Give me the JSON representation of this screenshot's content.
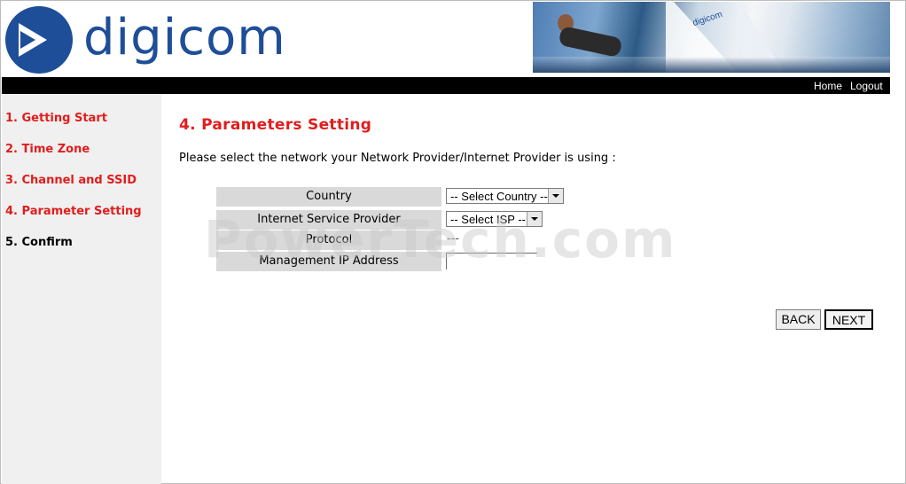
{
  "header": {
    "logo_text": "digicom",
    "banner_brand": "digicom",
    "links": {
      "home": "Home",
      "logout": "Logout"
    }
  },
  "sidebar": {
    "items": [
      {
        "label": "1. Getting Start",
        "current": false
      },
      {
        "label": "2. Time Zone",
        "current": false
      },
      {
        "label": "3. Channel and SSID",
        "current": false
      },
      {
        "label": "4. Parameter Setting",
        "current": false
      },
      {
        "label": "5. Confirm",
        "current": true
      }
    ]
  },
  "main": {
    "title": "4. Parameters Setting",
    "intro": "Please select the network your Network Provider/Internet Provider is using :",
    "form": {
      "country_label": "Country",
      "country_value": "-- Select Country --",
      "isp_label": "Internet Service Provider",
      "isp_value": "-- Select ISP --",
      "protocol_label": "Protocol",
      "protocol_value": "---",
      "mgmt_ip_label": "Management IP Address",
      "mgmt_ip_value": ""
    },
    "buttons": {
      "back": "BACK",
      "next": "NEXT"
    }
  },
  "watermark": "PowerTech.com",
  "colors": {
    "brand_blue": "#1f4e99",
    "accent_red": "#e11d1d",
    "sidebar_bg": "#f0f0f0",
    "topbar_bg": "#000000"
  }
}
